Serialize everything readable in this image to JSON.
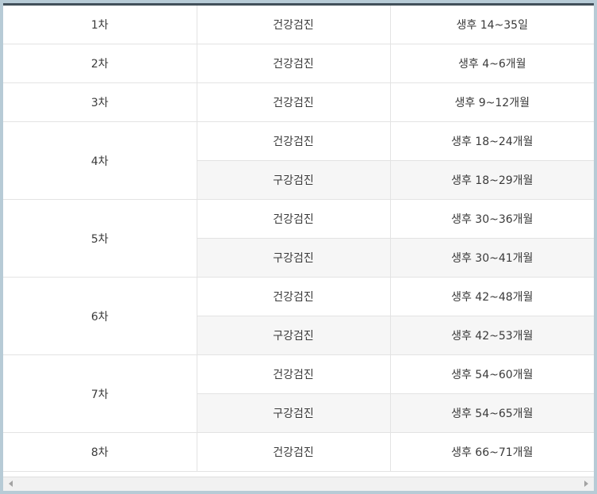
{
  "rows": [
    {
      "round": "1차",
      "type": "건강검진",
      "period": "생후 14~35일"
    },
    {
      "round": "2차",
      "type": "건강검진",
      "period": "생후 4~6개월"
    },
    {
      "round": "3차",
      "type": "건강검진",
      "period": "생후 9~12개월"
    },
    {
      "round": "4차",
      "type": "건강검진",
      "period": "생후 18~24개월"
    },
    {
      "type": "구강검진",
      "period": "생후 18~29개월"
    },
    {
      "round": "5차",
      "type": "건강검진",
      "period": "생후 30~36개월"
    },
    {
      "type": "구강검진",
      "period": "생후 30~41개월"
    },
    {
      "round": "6차",
      "type": "건강검진",
      "period": "생후 42~48개월"
    },
    {
      "type": "구강검진",
      "period": "생후 42~53개월"
    },
    {
      "round": "7차",
      "type": "건강검진",
      "period": "생후 54~60개월"
    },
    {
      "type": "구강검진",
      "period": "생후 54~65개월"
    },
    {
      "round": "8차",
      "type": "건강검진",
      "period": "생후 66~71개월"
    }
  ],
  "scrollbar": {
    "left_icon": "arrow-left-icon",
    "right_icon": "arrow-right-icon"
  },
  "colors": {
    "header_border": "#42505a",
    "shaded_row": "#f6f6f6",
    "frame_bg": "#b7cbd6"
  }
}
